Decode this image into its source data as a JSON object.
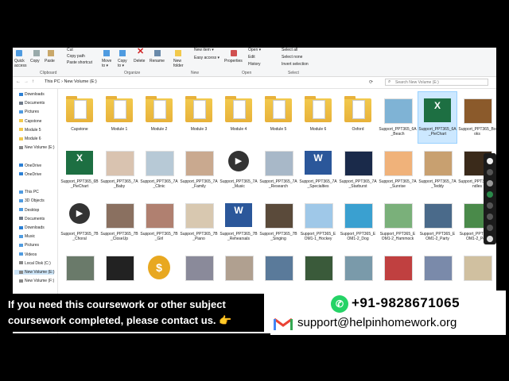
{
  "ribbon": {
    "clipboard": {
      "quick_access": "Quick\naccess",
      "copy": "Copy",
      "paste": "Paste",
      "cut": "Cut",
      "copy_path": "Copy path",
      "paste_shortcut": "Paste shortcut",
      "group": "Clipboard"
    },
    "organize": {
      "move_to": "Move\nto ▾",
      "copy_to": "Copy\nto ▾",
      "delete": "Delete",
      "rename": "Rename",
      "group": "Organize"
    },
    "new": {
      "new_folder": "New\nfolder",
      "new_item": "New item ▾",
      "easy_access": "Easy access ▾",
      "group": "New"
    },
    "open": {
      "properties": "Properties",
      "open": "Open ▾",
      "edit": "Edit",
      "history": "History",
      "group": "Open"
    },
    "select": {
      "select_all": "Select all",
      "select_none": "Select none",
      "invert_selection": "Invert selection",
      "group": "Select"
    }
  },
  "address": {
    "this_pc": "This PC",
    "separator": "›",
    "volume": "New Volume (E:)",
    "search_placeholder": "Search New Volume (E:)"
  },
  "nav": [
    {
      "label": "Downloads",
      "color": "#2b7fd4"
    },
    {
      "label": "Documents",
      "color": "#6f7b8a"
    },
    {
      "label": "Pictures",
      "color": "#4f9be0"
    },
    {
      "label": "Capstone",
      "color": "#f2c94c"
    },
    {
      "label": "Module 5",
      "color": "#f2c94c"
    },
    {
      "label": "Module 6",
      "color": "#f2c94c"
    },
    {
      "label": "New Volume (E:)",
      "color": "#888"
    },
    {
      "label": "",
      "color": ""
    },
    {
      "label": "OneDrive",
      "color": "#2b7fd4"
    },
    {
      "label": "OneDrive",
      "color": "#2b7fd4"
    },
    {
      "label": "",
      "color": ""
    },
    {
      "label": "This PC",
      "color": "#4f9be0"
    },
    {
      "label": "3D Objects",
      "color": "#4f9be0"
    },
    {
      "label": "Desktop",
      "color": "#4f9be0"
    },
    {
      "label": "Documents",
      "color": "#6f7b8a"
    },
    {
      "label": "Downloads",
      "color": "#2b7fd4"
    },
    {
      "label": "Music",
      "color": "#4f9be0"
    },
    {
      "label": "Pictures",
      "color": "#4f9be0"
    },
    {
      "label": "Videos",
      "color": "#4f9be0"
    },
    {
      "label": "Local Disk (C:)",
      "color": "#888"
    },
    {
      "label": "New Volume (E:)",
      "color": "#888"
    },
    {
      "label": "New Volume (F:)",
      "color": "#888"
    }
  ],
  "files": [
    {
      "name": "Capstone",
      "kind": "folder"
    },
    {
      "name": "Module 1",
      "kind": "folder"
    },
    {
      "name": "Module 2",
      "kind": "folder"
    },
    {
      "name": "Module 3",
      "kind": "folder"
    },
    {
      "name": "Module 4",
      "kind": "folder"
    },
    {
      "name": "Module 5",
      "kind": "folder"
    },
    {
      "name": "Module 6",
      "kind": "folder"
    },
    {
      "name": "Oxford",
      "kind": "folder"
    },
    {
      "name": "Support_PPT365_6A_Beach",
      "kind": "photo",
      "color": "#7fb3d5"
    },
    {
      "name": "Support_PPT365_6A_PieChart",
      "kind": "excel"
    },
    {
      "name": "Support_PPT365_Books",
      "kind": "photo",
      "color": "#8b5a2b"
    },
    {
      "name": "Support_PPT365_6B_PieChart",
      "kind": "excel"
    },
    {
      "name": "Support_PPT365_7A_Baby",
      "kind": "photo",
      "color": "#d9c3b0"
    },
    {
      "name": "Support_PPT365_7A_Clinic",
      "kind": "photo",
      "color": "#b7c9d6"
    },
    {
      "name": "Support_PPT365_7A_Family",
      "kind": "photo",
      "color": "#c9a98f"
    },
    {
      "name": "Support_PPT365_7A_Music",
      "kind": "video"
    },
    {
      "name": "Support_PPT365_7A_Research",
      "kind": "photo",
      "color": "#a8b8c8"
    },
    {
      "name": "Support_PPT365_7A_Specialties",
      "kind": "word"
    },
    {
      "name": "Support_PPT365_7A_Starburst",
      "kind": "photo",
      "color": "#1a2a4a"
    },
    {
      "name": "Support_PPT365_7A_Sunrise",
      "kind": "photo",
      "color": "#f0b27a"
    },
    {
      "name": "Support_PPT365_7A_Teddy",
      "kind": "photo",
      "color": "#c8a070"
    },
    {
      "name": "Support_PPT365_Candles",
      "kind": "photo",
      "color": "#3a2a1a"
    },
    {
      "name": "Support_PPT365_7B_Choral",
      "kind": "video"
    },
    {
      "name": "Support_PPT365_7B_CloseUp",
      "kind": "photo",
      "color": "#8a7060"
    },
    {
      "name": "Support_PPT365_7B_Girl",
      "kind": "photo",
      "color": "#b08070"
    },
    {
      "name": "Support_PPT365_7B_Piano",
      "kind": "photo",
      "color": "#d8c8b0"
    },
    {
      "name": "Support_PPT365_7B_Rehearsals",
      "kind": "word"
    },
    {
      "name": "Support_PPT365_7B_Singing",
      "kind": "photo",
      "color": "#5a4a3a"
    },
    {
      "name": "Support_PPT365_EOM1-1_Hockey",
      "kind": "photo",
      "color": "#9fc8e8"
    },
    {
      "name": "Support_PPT365_EOM1-2_Dog",
      "kind": "photo",
      "color": "#3aa0d0"
    },
    {
      "name": "Support_PPT365_EOM1-2_Hammock",
      "kind": "photo",
      "color": "#7ab07a"
    },
    {
      "name": "Support_PPT365_EOM1-2_Party",
      "kind": "photo",
      "color": "#4a6a8a"
    },
    {
      "name": "Support_PPT365_EOM1-2_Pool",
      "kind": "photo",
      "color": "#4a8a4a"
    },
    {
      "name": "",
      "kind": "photo",
      "color": "#6a7a6a"
    },
    {
      "name": "",
      "kind": "photo",
      "color": "#222"
    },
    {
      "name": "",
      "kind": "coin"
    },
    {
      "name": "",
      "kind": "photo",
      "color": "#8a8a9a"
    },
    {
      "name": "",
      "kind": "photo",
      "color": "#b0a090"
    },
    {
      "name": "",
      "kind": "photo",
      "color": "#5a7a9a"
    },
    {
      "name": "",
      "kind": "photo",
      "color": "#3a5a3a"
    },
    {
      "name": "",
      "kind": "photo",
      "color": "#7a9aaa"
    },
    {
      "name": "",
      "kind": "photo",
      "color": "#c04040"
    },
    {
      "name": "",
      "kind": "photo",
      "color": "#7a8aaa"
    },
    {
      "name": "",
      "kind": "photo",
      "color": "#d0c0a0"
    },
    {
      "name": "",
      "kind": "hammer"
    }
  ],
  "selected_file": "Support_PPT365_6A_PieChart",
  "banner": {
    "line1": "If you need this coursework or other subject",
    "line2": "coursework completed, please contact us. 👉"
  },
  "contact": {
    "phone": "+91-9828671065",
    "email": "support@helpinhomework.org",
    "whatsapp_icon": "whatsapp-icon",
    "gmail_icon": "gmail-icon"
  },
  "colors": {
    "whatsapp": "#25d366",
    "selection": "#cce8ff",
    "folder": "#f2c94c"
  }
}
